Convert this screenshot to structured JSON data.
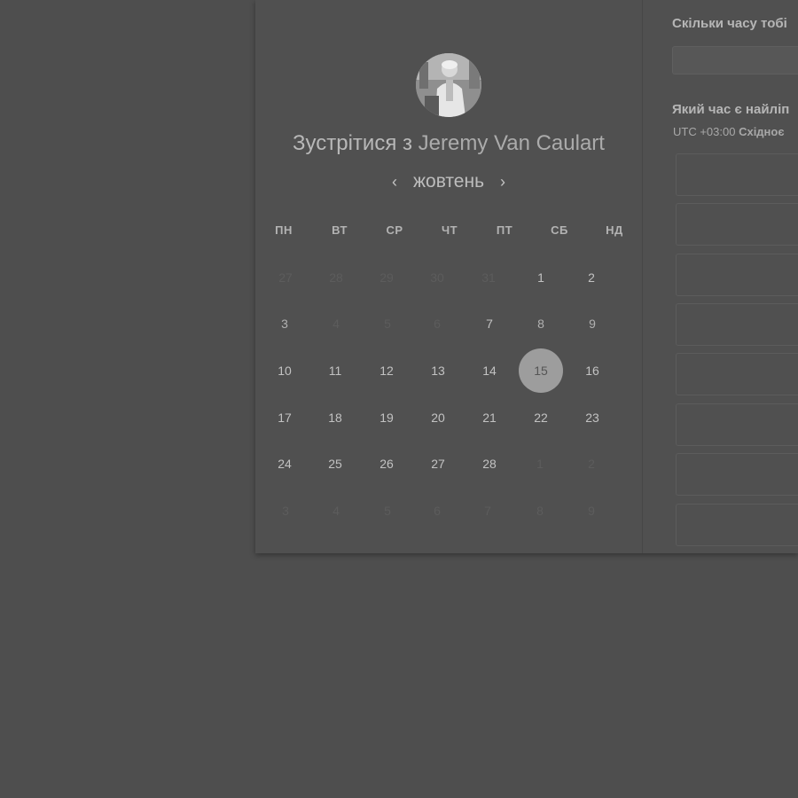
{
  "booking": {
    "title_prefix": "Зустрітися з",
    "host_name": "Jeremy Van Caulart",
    "month": "жовтень",
    "prev_symbol": "‹",
    "next_symbol": "›",
    "weekdays": [
      "ПН",
      "ВТ",
      "СР",
      "ЧТ",
      "ПТ",
      "СБ",
      "НД"
    ],
    "weeks": [
      [
        "27",
        "28",
        "29",
        "30",
        "31",
        "1",
        "2"
      ],
      [
        "3",
        "4",
        "5",
        "6",
        "7",
        "8",
        "9"
      ],
      [
        "10",
        "11",
        "12",
        "13",
        "14",
        "15",
        "16"
      ],
      [
        "17",
        "18",
        "19",
        "20",
        "21",
        "22",
        "23"
      ],
      [
        "24",
        "25",
        "26",
        "27",
        "28",
        "1",
        "2"
      ],
      [
        "3",
        "4",
        "5",
        "6",
        "7",
        "8",
        "9"
      ]
    ],
    "selected_day": "15"
  },
  "right": {
    "question_duration": "Скільки часу тобі",
    "question_time": "Який час є найліп",
    "timezone_offset": "UTC +03:00",
    "timezone_name": "Східноє"
  },
  "colors": {
    "background": "#4e4e4e",
    "card": "#505050",
    "selected": "#9d9d9d"
  },
  "icons": {
    "prev": "chevron-left-icon",
    "next": "chevron-right-icon"
  }
}
